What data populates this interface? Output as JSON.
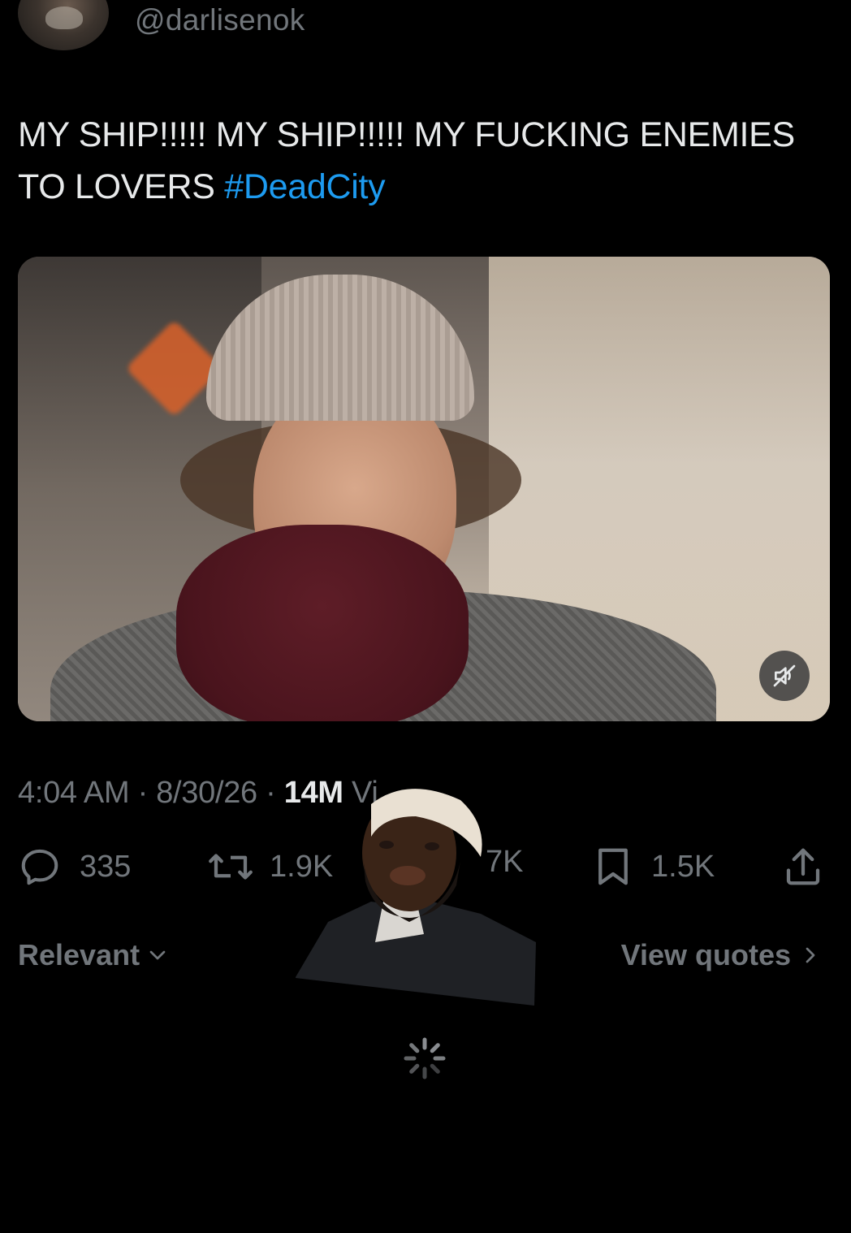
{
  "tweet": {
    "handle": "@darlisenok",
    "text_main": "MY SHIP!!!!! MY SHIP!!!!! MY FUCKING ENEMIES TO LOVERS ",
    "hashtag": "#DeadCity",
    "timestamp": "4:04 AM · 8/30/26 · ",
    "views_count": "14M",
    "views_label": " Vi"
  },
  "actions": {
    "replies": "335",
    "reposts": "1.9K",
    "likes_partial": "7K",
    "bookmarks": "1.5K"
  },
  "sort": {
    "label": "Relevant",
    "view_quotes": "View quotes"
  },
  "icons": {
    "reply": "reply-icon",
    "repost": "repost-icon",
    "bookmark": "bookmark-icon",
    "share": "share-icon",
    "mute": "volume-muted-icon",
    "spinner": "loading-spinner-icon"
  },
  "colors": {
    "background": "#000000",
    "text": "#e7e9ea",
    "secondary": "#71767b",
    "accent": "#1d9bf0"
  }
}
